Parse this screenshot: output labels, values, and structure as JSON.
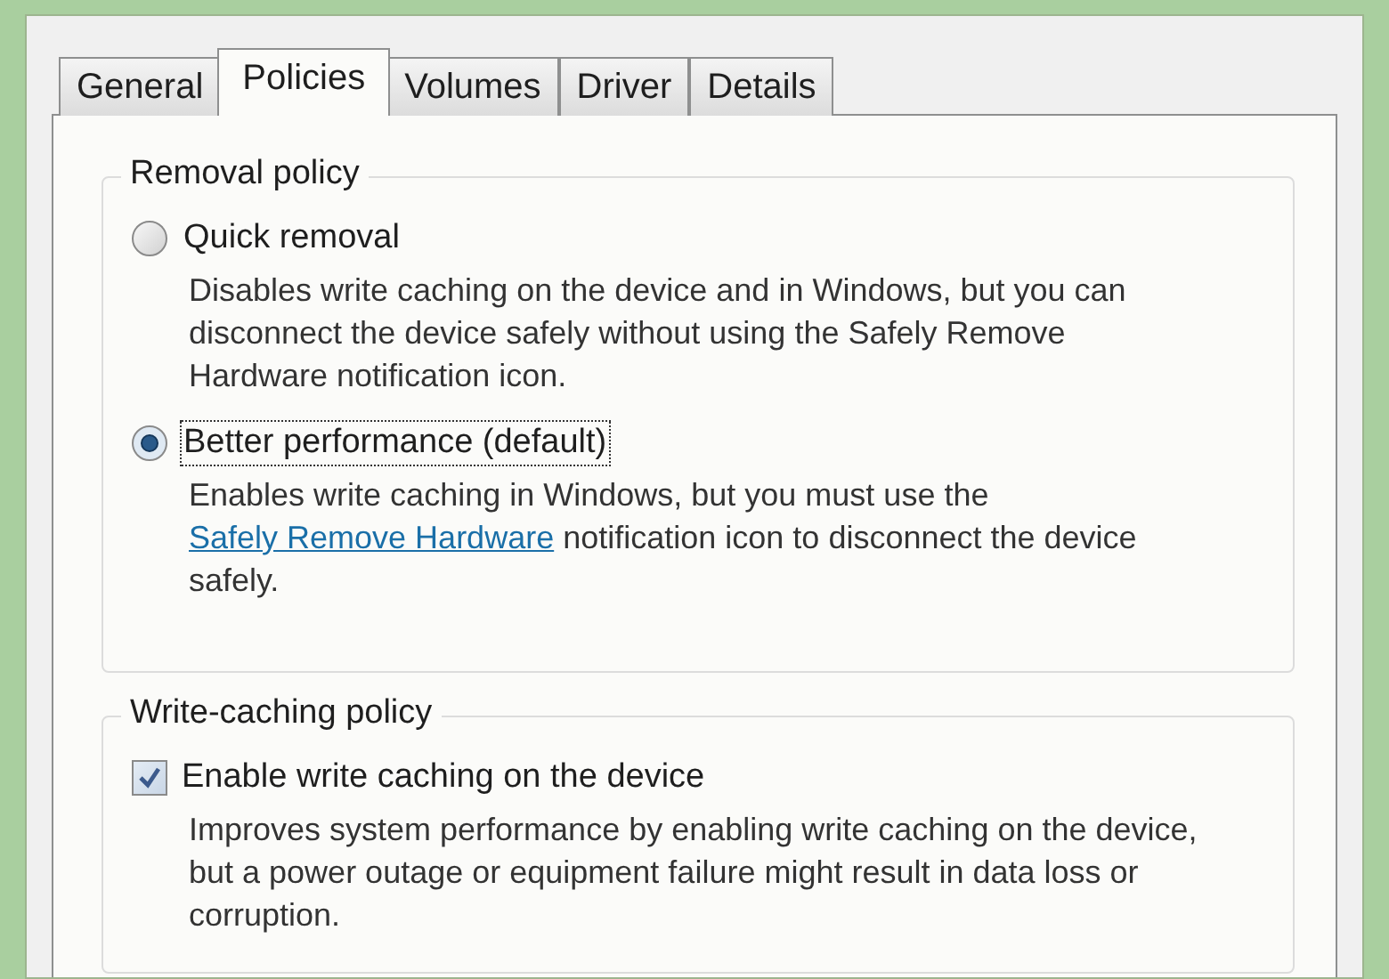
{
  "tabs": [
    {
      "label": "General",
      "selected": false
    },
    {
      "label": "Policies",
      "selected": true
    },
    {
      "label": "Volumes",
      "selected": false
    },
    {
      "label": "Driver",
      "selected": false
    },
    {
      "label": "Details",
      "selected": false
    }
  ],
  "removal_policy": {
    "title": "Removal policy",
    "options": [
      {
        "label": "Quick removal",
        "selected": false,
        "focused": false,
        "description": [
          {
            "kind": "text",
            "text": "Disables write caching on the device and in Windows, but you can disconnect the device safely without using the Safely Remove Hardware notification icon."
          }
        ]
      },
      {
        "label": "Better performance (default)",
        "selected": true,
        "focused": true,
        "description": [
          {
            "kind": "text",
            "text": "Enables write caching in Windows, but you must use the"
          },
          {
            "kind": "link",
            "text": "Safely Remove Hardware"
          },
          {
            "kind": "text",
            "text": "notification icon to disconnect the device safely."
          }
        ]
      }
    ]
  },
  "write_caching_policy": {
    "title": "Write-caching policy",
    "options": [
      {
        "label": "Enable write caching on the device",
        "checked": true,
        "description": "Improves system performance by enabling write caching on the device, but a power outage or equipment failure might result in data loss or corruption."
      }
    ]
  }
}
